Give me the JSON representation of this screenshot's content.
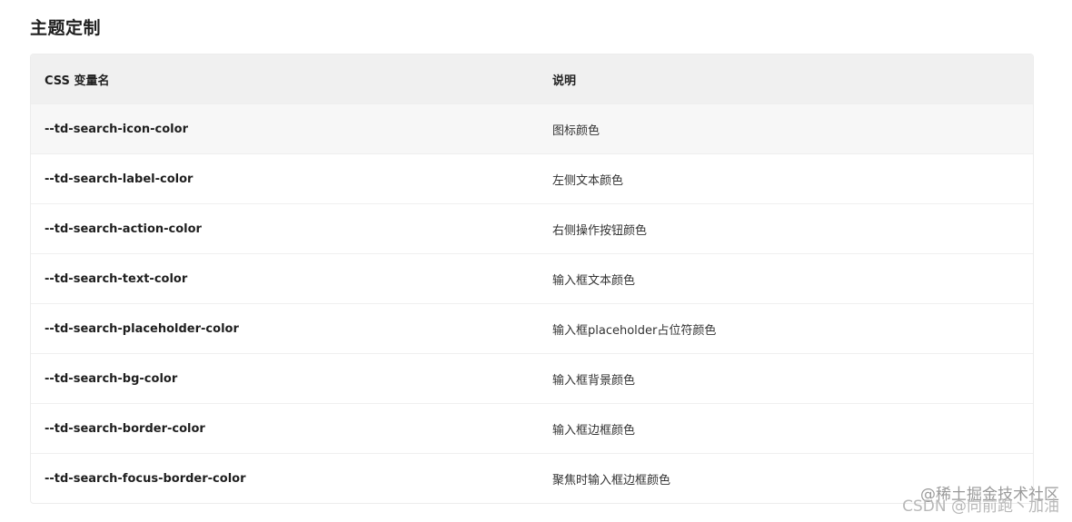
{
  "title": "主题定制",
  "table": {
    "headers": [
      "CSS 变量名",
      "说明"
    ],
    "rows": [
      [
        "--td-search-icon-color",
        "图标颜色"
      ],
      [
        "--td-search-label-color",
        "左侧文本颜色"
      ],
      [
        "--td-search-action-color",
        "右侧操作按钮颜色"
      ],
      [
        "--td-search-text-color",
        "输入框文本颜色"
      ],
      [
        "--td-search-placeholder-color",
        "输入框placeholder占位符颜色"
      ],
      [
        "--td-search-bg-color",
        "输入框背景颜色"
      ],
      [
        "--td-search-border-color",
        "输入框边框颜色"
      ],
      [
        "--td-search-focus-border-color",
        "聚焦时输入框边框颜色"
      ]
    ]
  },
  "watermark": {
    "line1": "@稀土掘金技术社区",
    "line2": "CSDN @向前跑丶加油"
  }
}
